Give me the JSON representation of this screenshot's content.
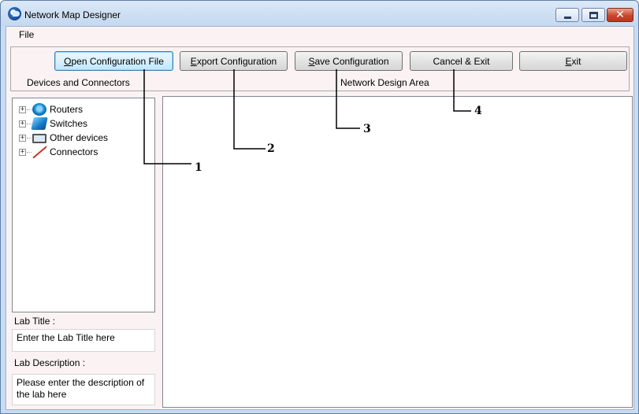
{
  "window": {
    "title": "Network Map Designer"
  },
  "menu": {
    "file": "File"
  },
  "toolbar": {
    "buttons": [
      {
        "prefix": "",
        "accel": "O",
        "rest": "pen Configuration File"
      },
      {
        "prefix": "",
        "accel": "E",
        "rest": "xport Configuration"
      },
      {
        "prefix": "",
        "accel": "S",
        "rest": "ave Configuration"
      },
      {
        "prefix": "Cancel & Exit",
        "accel": "",
        "rest": ""
      },
      {
        "prefix": "",
        "accel": "E",
        "rest": "xit"
      }
    ],
    "devices_label": "Devices and Connectors",
    "design_label": "Network Design Area"
  },
  "tree": {
    "items": [
      {
        "label": "Routers",
        "icon": "router-icon"
      },
      {
        "label": "Switches",
        "icon": "switch-icon"
      },
      {
        "label": "Other devices",
        "icon": "computer-icon"
      },
      {
        "label": "Connectors",
        "icon": "connector-icon"
      }
    ]
  },
  "lab": {
    "title_label": "Lab Title :",
    "title_value": "Enter the Lab Title here",
    "description_label": "Lab Description :",
    "description_value": "Please enter the description of the lab here"
  },
  "callouts": [
    "1",
    "2",
    "3",
    "4"
  ]
}
